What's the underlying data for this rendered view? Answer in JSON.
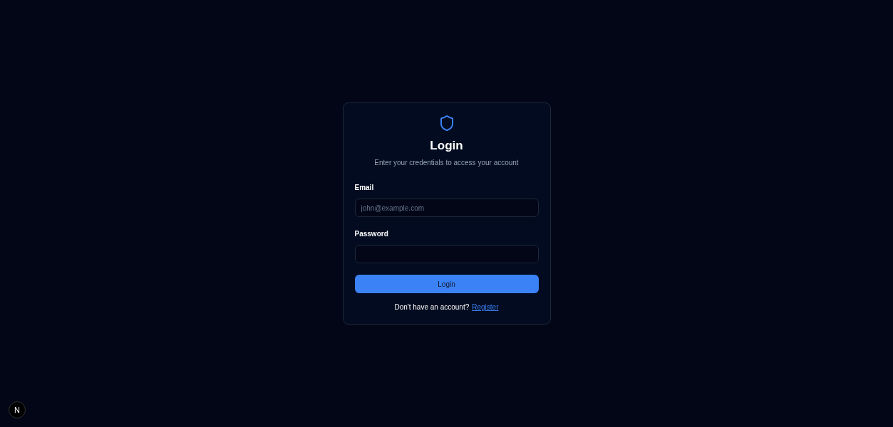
{
  "card": {
    "title": "Login",
    "subtitle": "Enter your credentials to access your account"
  },
  "fields": [
    {
      "label": "Email",
      "placeholder": "john@example.com"
    },
    {
      "label": "Password"
    }
  ],
  "submit": {
    "label": "Login"
  },
  "footer": {
    "text": "Don't have an account?",
    "link": "Register"
  },
  "dev_badge": {
    "label": "N"
  }
}
